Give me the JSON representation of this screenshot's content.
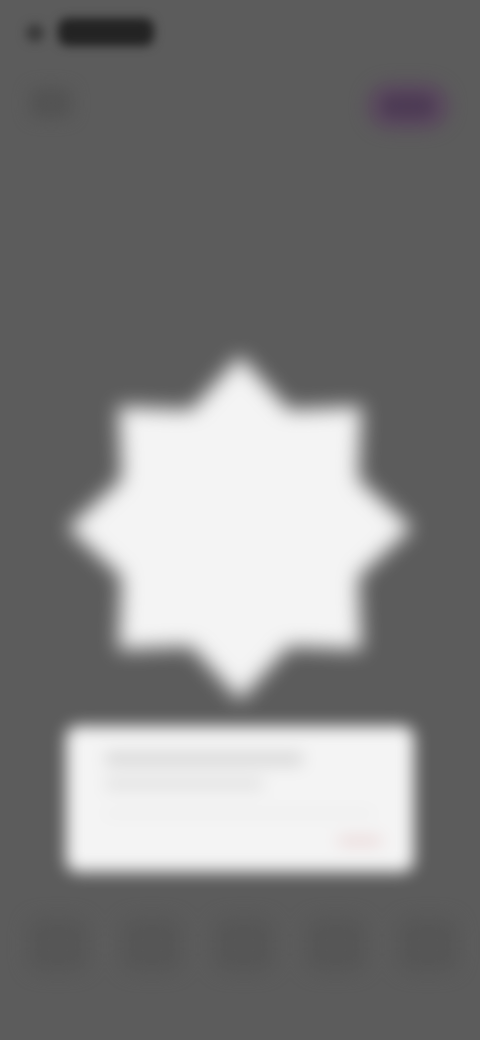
{
  "status_bar": {
    "time": ""
  },
  "header": {
    "action_label": ""
  },
  "prompt_card": {
    "text": "",
    "placeholder": ""
  },
  "bottom_nav": {
    "items": [
      {
        "icon": "nav-icon-1"
      },
      {
        "icon": "nav-icon-2"
      },
      {
        "icon": "nav-icon-3"
      },
      {
        "icon": "nav-icon-4"
      },
      {
        "icon": "nav-icon-5"
      }
    ]
  },
  "colors": {
    "background": "#5c5c5c",
    "badge": "#f4f4f4",
    "accent_button": "#5a4a5e",
    "card": "#f4f4f4"
  }
}
